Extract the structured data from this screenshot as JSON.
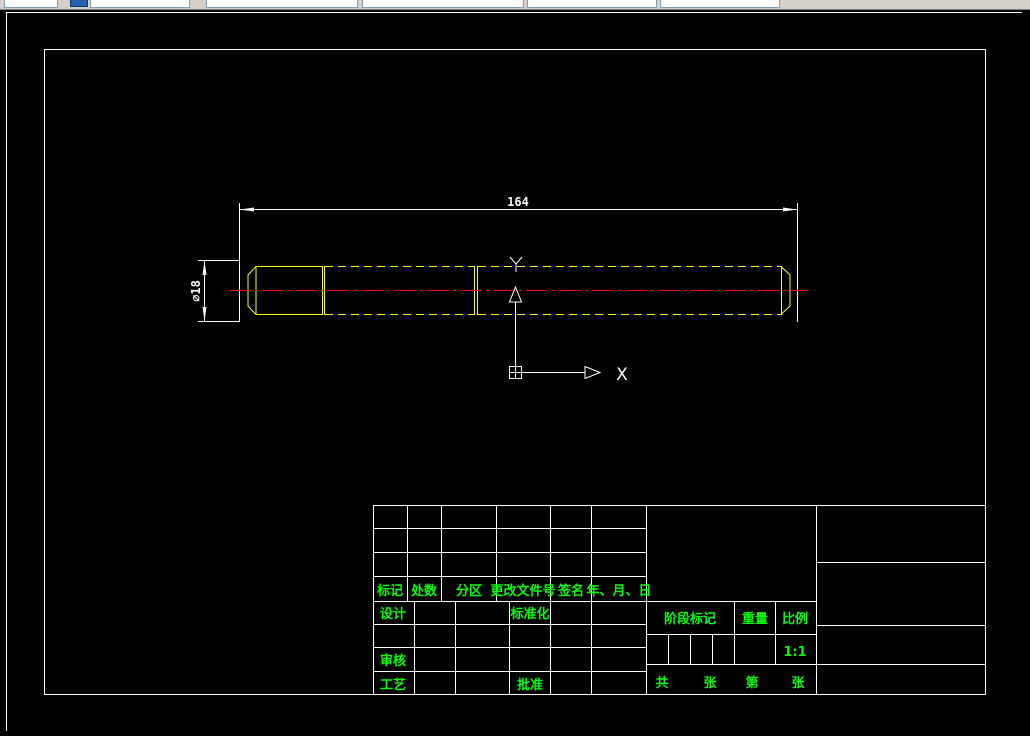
{
  "colors": {
    "background": "#000000",
    "border": "#ffffff",
    "part_outline": "#ffff00",
    "centerline": "#ff0000",
    "title_text": "#00ff00"
  },
  "toolbar": {
    "controls": [
      "layer-selector",
      "linetype-selector",
      "lineweight-selector",
      "color-selector",
      "plot-style-selector"
    ]
  },
  "drawing": {
    "dimension_length": "164",
    "dimension_diameter": "⌀18",
    "ucs_x_label": "X",
    "ucs_y_label": "Y"
  },
  "title_block": {
    "headers": [
      "标记",
      "处数",
      "分区",
      "更改文件号",
      "签名",
      "年、月、日"
    ],
    "design": "设计",
    "standardization": "标准化",
    "review": "审核",
    "process": "工艺",
    "approve": "批准",
    "stage_mark": "阶段标记",
    "weight": "重量",
    "scale_label": "比例",
    "scale_value": "1:1",
    "total": "共",
    "sheets": "张",
    "sheet_no": "第",
    "sheets2": "张"
  }
}
